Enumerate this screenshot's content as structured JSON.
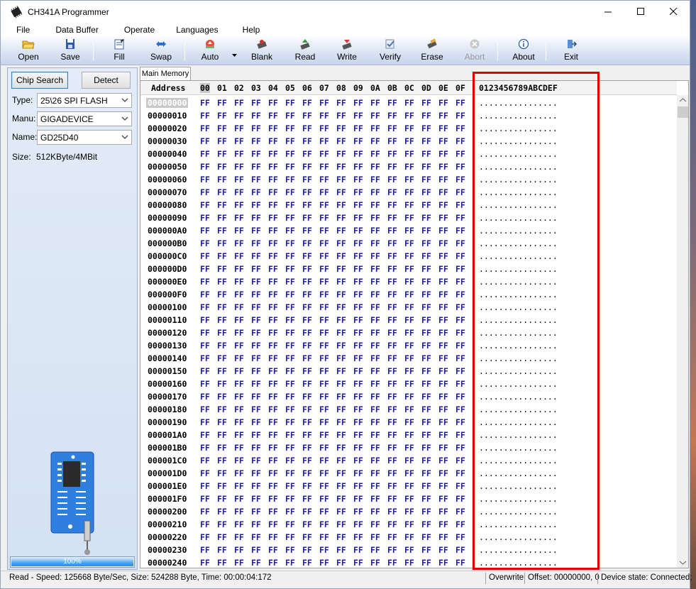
{
  "window": {
    "title": "CH341A Programmer"
  },
  "menu": [
    "File",
    "Data Buffer",
    "Operate",
    "Languages",
    "Help"
  ],
  "toolbar": {
    "open": "Open",
    "save": "Save",
    "fill": "Fill",
    "swap": "Swap",
    "auto": "Auto",
    "blank": "Blank",
    "read": "Read",
    "write": "Write",
    "verify": "Verify",
    "erase": "Erase",
    "abort": "Abort",
    "about": "About",
    "exit": "Exit"
  },
  "left": {
    "chip_search": "Chip Search",
    "detect": "Detect",
    "type_label": "Type:",
    "type_value": "25\\26 SPI FLASH",
    "manu_label": "Manu:",
    "manu_value": "GIGADEVICE",
    "name_label": "Name:",
    "name_value": "GD25D40",
    "size_label": "Size:",
    "size_value": "512KByte/4MBit",
    "progress": "100%",
    "progress_value": 1.0
  },
  "tab": "Main Memory",
  "hex": {
    "address_header": "Address",
    "columns": [
      "00",
      "01",
      "02",
      "03",
      "04",
      "05",
      "06",
      "07",
      "08",
      "09",
      "0A",
      "0B",
      "0C",
      "0D",
      "0E",
      "0F"
    ],
    "ascii_header": "0123456789ABCDEF",
    "addresses": [
      "00000000",
      "00000010",
      "00000020",
      "00000030",
      "00000040",
      "00000050",
      "00000060",
      "00000070",
      "00000080",
      "00000090",
      "000000A0",
      "000000B0",
      "000000C0",
      "000000D0",
      "000000E0",
      "000000F0",
      "00000100",
      "00000110",
      "00000120",
      "00000130",
      "00000140",
      "00000150",
      "00000160",
      "00000170",
      "00000180",
      "00000190",
      "000001A0",
      "000001B0",
      "000001C0",
      "000001D0",
      "000001E0",
      "000001F0",
      "00000200",
      "00000210",
      "00000220",
      "00000230",
      "00000240"
    ],
    "byte": "FF",
    "ascii_row": "................"
  },
  "status": {
    "main": "Read - Speed: 125668 Byte/Sec, Size: 524288 Byte, Time: 00:00:04:172",
    "mode": "Overwrite",
    "offset": "Offset: 00000000, 0",
    "device": "Device state: Connected;"
  },
  "colors": {
    "hex_byte": "#1f1fa0",
    "highlight_box": "#e00000",
    "progress": "#2f8de4"
  }
}
